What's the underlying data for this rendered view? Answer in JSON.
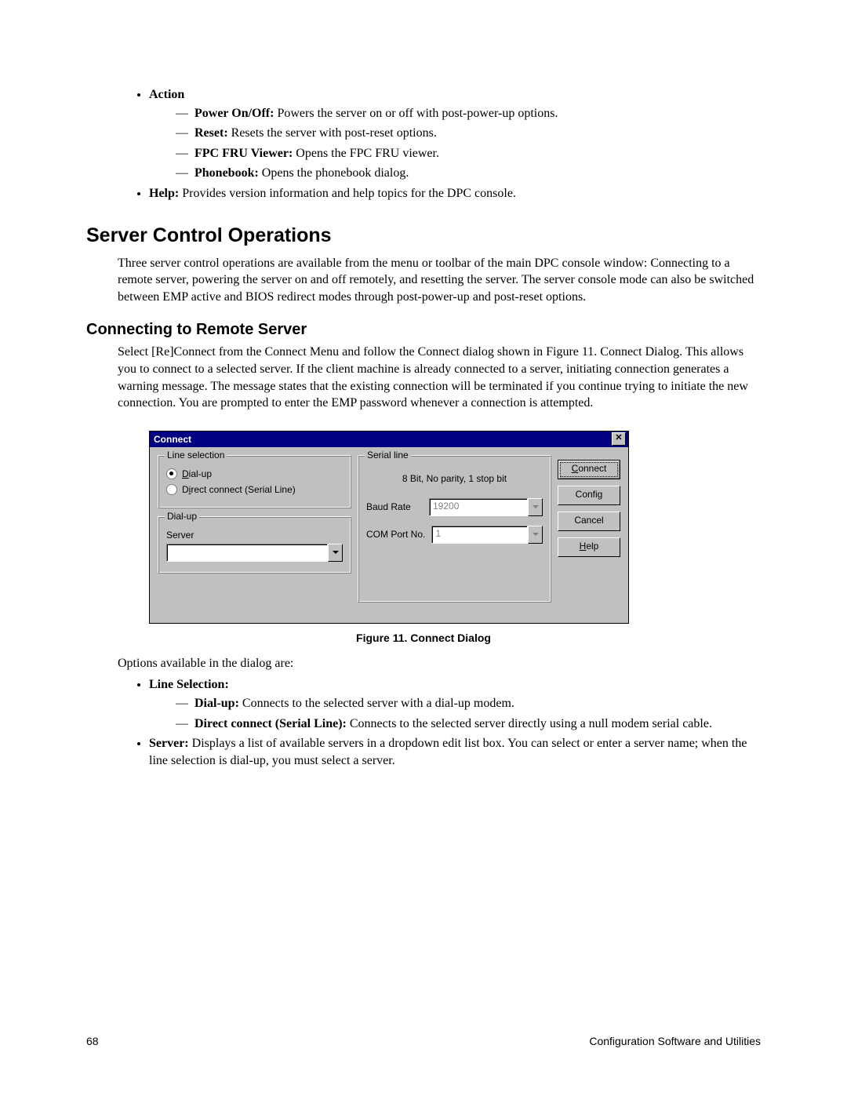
{
  "top_bullets": {
    "action": {
      "label": "Action",
      "items": [
        {
          "term": "Power On/Off:",
          "desc": "  Powers the server on or off with post-power-up options."
        },
        {
          "term": "Reset:",
          "desc": "  Resets the server with post-reset options."
        },
        {
          "term": "FPC FRU Viewer:",
          "desc": "  Opens the FPC FRU viewer."
        },
        {
          "term": "Phonebook:",
          "desc": "  Opens the phonebook dialog."
        }
      ]
    },
    "help": {
      "term": "Help:",
      "desc": "  Provides version information and help topics for the DPC console."
    }
  },
  "section1": {
    "title": "Server Control Operations",
    "para": "Three server control operations are available from the menu or toolbar of the main DPC console window:  Connecting to a remote server, powering the server on and off remotely, and resetting the server.  The server console mode can also be switched between EMP active and BIOS redirect modes through post-power-up and post-reset options."
  },
  "section2": {
    "title": "Connecting to Remote Server",
    "para": "Select [Re]Connect from the Connect Menu and follow the Connect dialog shown in Figure 11. Connect Dialog.  This allows you to connect to a selected server.  If the client machine is already connected to a server, initiating connection generates a warning message.  The message states that the existing connection will be terminated if you continue trying to initiate the new connection.  You are prompted to enter the EMP password whenever a connection is attempted."
  },
  "dialog": {
    "title": "Connect",
    "group_lineselection": "Line selection",
    "radio_dialup": "Dial-up",
    "radio_direct": "Direct connect (Serial Line)",
    "group_dialup": "Dial-up",
    "label_server": "Server",
    "group_serial": "Serial line",
    "serial_info": "8 Bit, No parity, 1 stop bit",
    "label_baud": "Baud Rate",
    "value_baud": "19200",
    "label_comport": "COM Port No.",
    "value_comport": "1",
    "btn_connect": "Connect",
    "btn_config": "Config",
    "btn_cancel": "Cancel",
    "btn_help": "Help"
  },
  "figure_caption": "Figure 11.  Connect Dialog",
  "after_figure": {
    "intro": "Options available in the dialog are:",
    "lineselection": {
      "term": "Line Selection:",
      "items": [
        {
          "term": "Dial-up:",
          "desc": "  Connects to the selected server with a dial-up modem."
        },
        {
          "term": "Direct connect (Serial Line):",
          "desc": "  Connects to the selected server directly using a null modem serial cable."
        }
      ]
    },
    "server": {
      "term": "Server:",
      "desc": "  Displays a list of available servers in a dropdown edit list box.  You can select or enter a server name; when the line selection is dial-up, you must select a server."
    }
  },
  "footer": {
    "page": "68",
    "title": "Configuration Software and Utilities"
  }
}
